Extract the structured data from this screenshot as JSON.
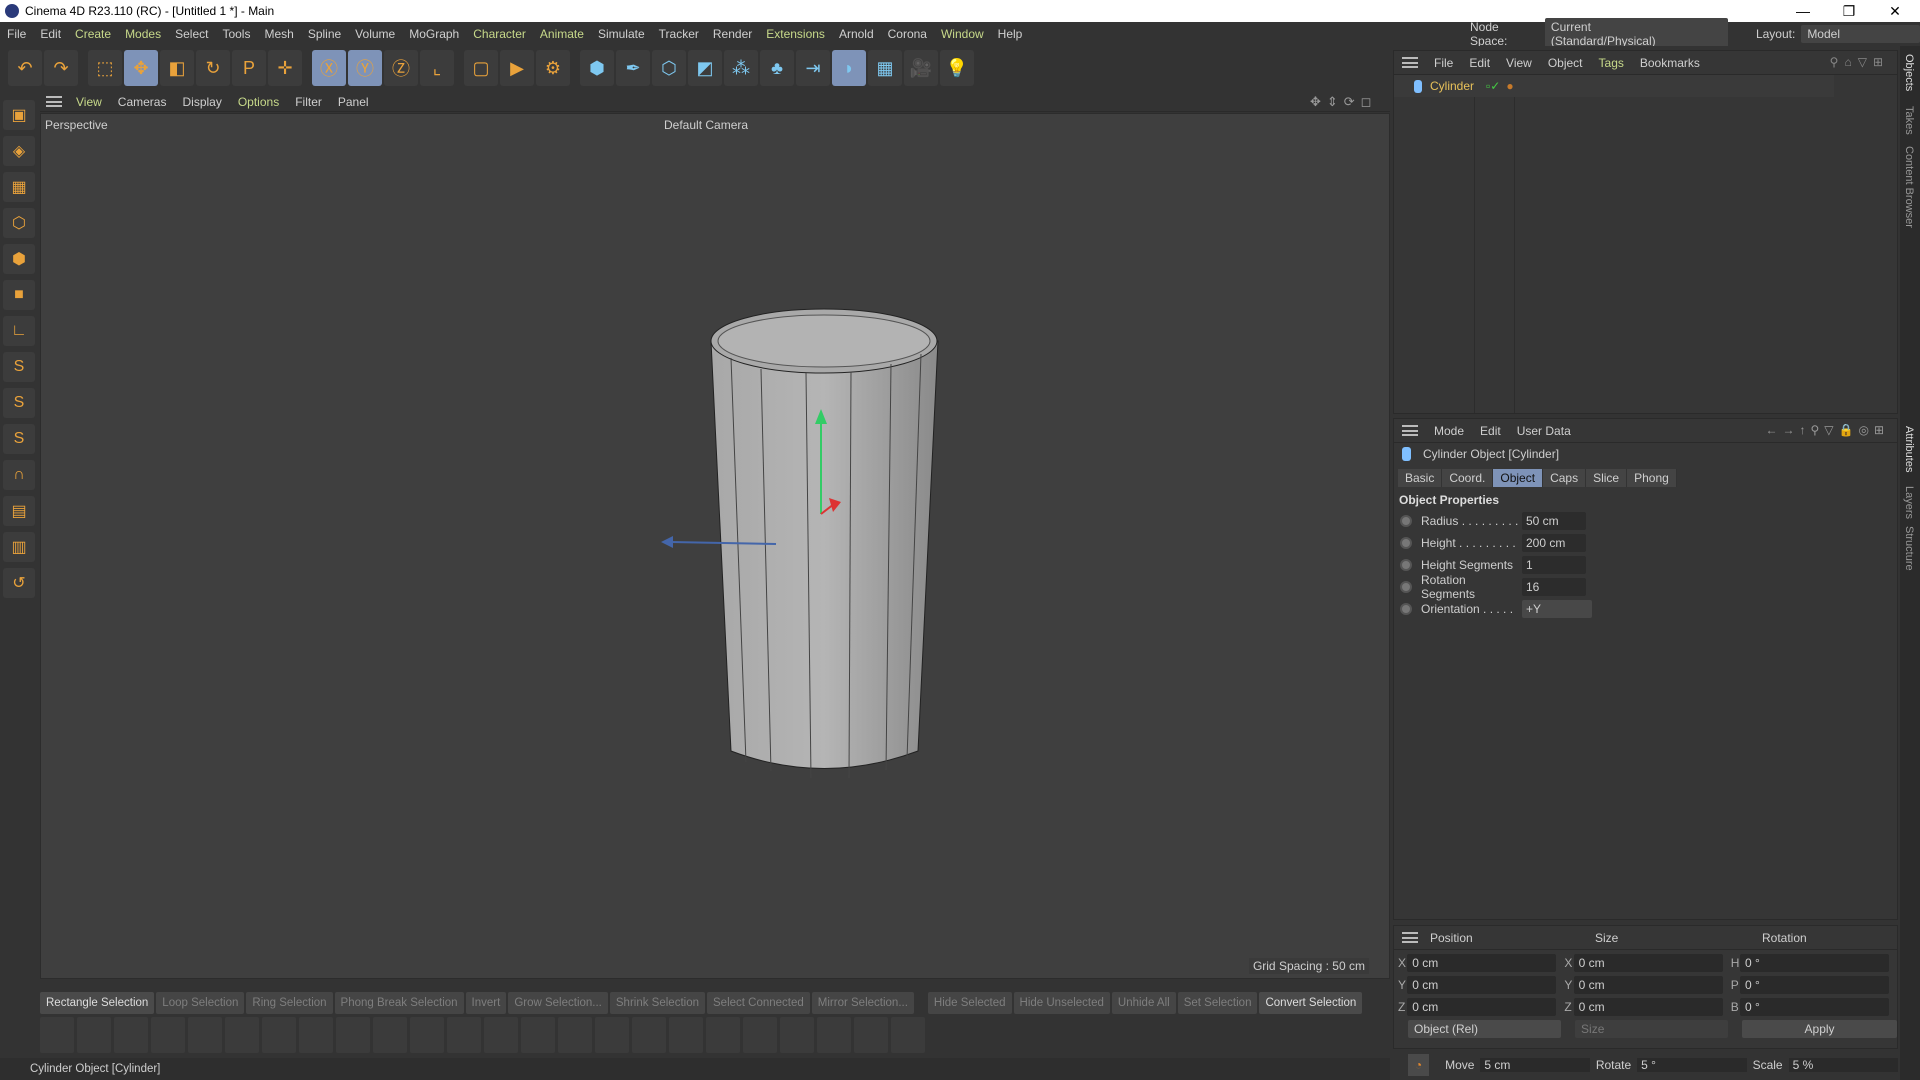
{
  "window": {
    "title": "Cinema 4D R23.110 (RC) - [Untitled 1 *] - Main",
    "minimize": "—",
    "restore": "❐",
    "close": "✕"
  },
  "menu": [
    "File",
    "Edit",
    "Create",
    "Modes",
    "Select",
    "Tools",
    "Mesh",
    "Spline",
    "Volume",
    "MoGraph",
    "Character",
    "Animate",
    "Simulate",
    "Tracker",
    "Render",
    "Extensions",
    "Arnold",
    "Corona",
    "Window",
    "Help"
  ],
  "menu_highlight": [
    "Create",
    "Modes",
    "Character",
    "Animate",
    "Extensions",
    "Window"
  ],
  "node_space": {
    "label": "Node Space:",
    "value": "Current (Standard/Physical)"
  },
  "layout": {
    "label": "Layout:",
    "value": "Model"
  },
  "toolbar_icons": [
    "undo-icon",
    "redo-icon",
    "live-selection-icon",
    "move-icon",
    "scale-icon",
    "rotate-icon",
    "psr-icon",
    "add-icon",
    "x-axis-icon",
    "y-axis-icon",
    "z-axis-icon",
    "coordinate-system-icon",
    "render-view-icon",
    "render-icon",
    "render-settings-icon",
    "cube-icon",
    "pen-icon",
    "subdivision-icon",
    "extrude-icon",
    "cloner-icon",
    "voronoi-icon",
    "deformer-icon",
    "bend-icon",
    "floor-icon",
    "camera-icon",
    "light-icon"
  ],
  "viewport": {
    "menu": [
      "View",
      "Cameras",
      "Display",
      "Options",
      "Filter",
      "Panel"
    ],
    "name": "Perspective",
    "camera": "Default Camera",
    "grid_spacing": "Grid Spacing : 50 cm"
  },
  "objects_panel": {
    "menu": [
      "File",
      "Edit",
      "View",
      "Object",
      "Tags",
      "Bookmarks"
    ],
    "objects": [
      {
        "name": "Cylinder"
      }
    ]
  },
  "attributes": {
    "menu": [
      "Mode",
      "Edit",
      "User Data"
    ],
    "object_title": "Cylinder Object [Cylinder]",
    "tabs": [
      "Basic",
      "Coord.",
      "Object",
      "Caps",
      "Slice",
      "Phong"
    ],
    "active_tab": "Object",
    "section": "Object Properties",
    "props": [
      {
        "label": "Radius . . . . . . . . .",
        "value": "50 cm"
      },
      {
        "label": "Height . . . . . . . . .",
        "value": "200 cm"
      },
      {
        "label": "Height Segments",
        "value": "1"
      },
      {
        "label": "Rotation Segments",
        "value": "16"
      },
      {
        "label": "Orientation . . . . .",
        "value": "+Y"
      }
    ]
  },
  "coordinates": {
    "headers": [
      "Position",
      "Size",
      "Rotation"
    ],
    "rows": [
      {
        "a": "X",
        "p": "0 cm",
        "sa": "X",
        "s": "0 cm",
        "ra": "H",
        "r": "0 °"
      },
      {
        "a": "Y",
        "p": "0 cm",
        "sa": "Y",
        "s": "0 cm",
        "ra": "P",
        "r": "0 °"
      },
      {
        "a": "Z",
        "p": "0 cm",
        "sa": "Z",
        "s": "0 cm",
        "ra": "B",
        "r": "0 °"
      }
    ],
    "mode": "Object (Rel)",
    "size_mode": "Size",
    "apply": "Apply"
  },
  "snap": {
    "move_label": "Move",
    "move": "5 cm",
    "rotate_label": "Rotate",
    "rotate": "5 °",
    "scale_label": "Scale",
    "scale": "5 %"
  },
  "side_tabs": [
    "Objects",
    "Takes",
    "Content Browser",
    "Attributes",
    "Layers",
    "Structure"
  ],
  "selection_bar": [
    "Rectangle Selection",
    "Loop Selection",
    "Ring Selection",
    "Phong Break Selection",
    "Invert",
    "Grow Selection...",
    "Shrink Selection",
    "Select Connected",
    "Mirror Selection...",
    "Hide Selected",
    "Hide Unselected",
    "Unhide All",
    "Set Selection",
    "Convert Selection"
  ],
  "status": "Cylinder Object [Cylinder]"
}
